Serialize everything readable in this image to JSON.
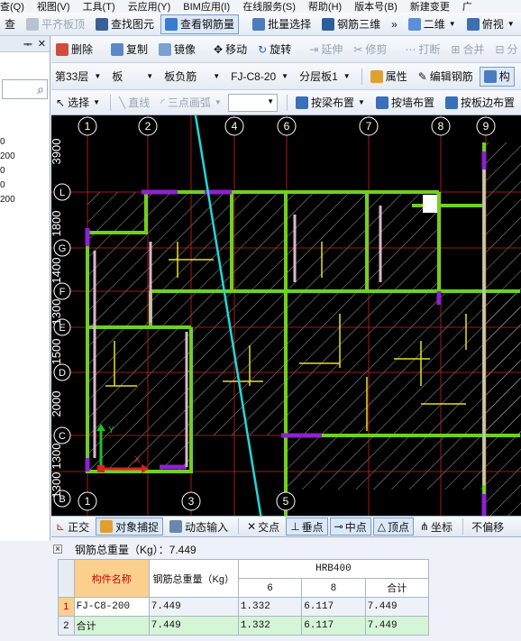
{
  "menubar": {
    "items": [
      "查(Q)",
      "视图(V)",
      "工具(T)",
      "云应用(Y)",
      "BIM应用(I)",
      "在线服务(S)",
      "帮助(H)",
      "版本号(B)",
      "新建变更",
      "广"
    ]
  },
  "toolbar1": {
    "items": [
      {
        "label": "查",
        "icon": "view-icon"
      },
      {
        "label": "平齐板顶",
        "icon": "align-top-icon"
      },
      {
        "label": "查找图元",
        "icon": "binoculars-icon"
      },
      {
        "label": "查看钢筋量",
        "icon": "rebar-quantity-icon"
      },
      {
        "label": "批量选择",
        "icon": "batch-select-icon"
      },
      {
        "label": "钢筋三维",
        "icon": "rebar-3d-icon"
      },
      {
        "label": "二维",
        "icon": "2d-icon"
      },
      {
        "label": "俯视",
        "icon": "top-view-icon"
      }
    ]
  },
  "leftpanel": {
    "pin": "ᆍ",
    "close": "✕",
    "values": [
      "0",
      "200",
      "0",
      "0",
      "200"
    ]
  },
  "toolbar2": {
    "items": [
      "删除",
      "复制",
      "镜像",
      "移动",
      "旋转",
      "延伸",
      "修剪",
      "打断",
      "合并",
      "分"
    ]
  },
  "toolbar3": {
    "floor": "第33层",
    "component_type": "板",
    "subtype": "板负筋",
    "component": "FJ-C8-20",
    "layer": "分层板1",
    "properties": "属性",
    "edit_rebar": "编辑钢筋",
    "component_list": "构"
  },
  "toolbar4": {
    "select": "选择",
    "line": "直线",
    "arc": "三点画弧",
    "beam_place": "按梁布置",
    "wall_place": "按墙布置",
    "edge_place": "按板边布置"
  },
  "canvas": {
    "colors": {
      "background": "#000000",
      "axis": "#d02020",
      "slab": "#b0b0b0",
      "beam": "#70d020",
      "wall": "#9020d0",
      "rebar": "#e8e020",
      "bubble": "#ffffff"
    },
    "axis_top": [
      "1",
      "2",
      "4",
      "6",
      "7",
      "8",
      "9"
    ],
    "axis_bottom": [
      "1",
      "3",
      "5"
    ],
    "axis_left": [
      "L",
      "G",
      "F",
      "E",
      "D",
      "C",
      "B"
    ],
    "dims_left": [
      "3900",
      "1800",
      "1400",
      "1300",
      "1500",
      "2000",
      "1300",
      "1300"
    ],
    "coord_x": "X",
    "coord_y": "Y"
  },
  "snapbar": {
    "items": [
      "正交",
      "对象捕捉",
      "动态输入",
      "交点",
      "垂点",
      "中点",
      "顶点",
      "坐标",
      "不偏移"
    ]
  },
  "result": {
    "summary": "钢筋总重量（Kg）：7.449",
    "headers": {
      "name": "构件名称",
      "total": "钢筋总重量（Kg）",
      "grade": "HRB400",
      "d6": "6",
      "d8": "8",
      "sum": "合计"
    },
    "rows": [
      {
        "num": "1",
        "name": "FJ-C8-200",
        "total": "7.449",
        "d6": "1.332",
        "d8": "6.117",
        "sum": "7.449"
      },
      {
        "num": "2",
        "name": "合计",
        "total": "7.449",
        "d6": "1.332",
        "d8": "6.117",
        "sum": "7.449"
      }
    ]
  }
}
